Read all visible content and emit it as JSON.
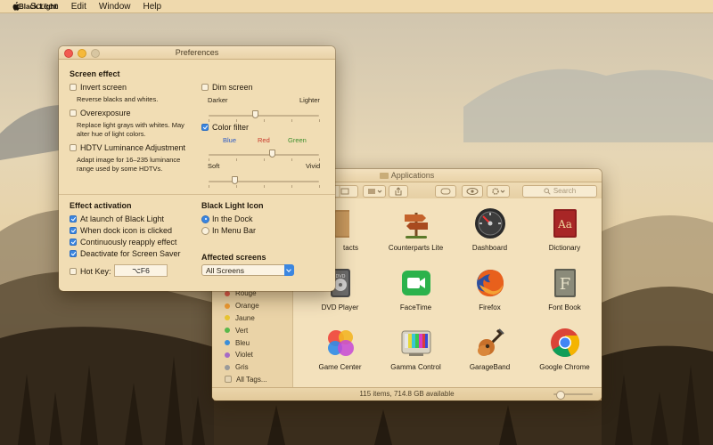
{
  "menubar": {
    "apple": "apple-logo-icon",
    "app_name": "Black Light",
    "items": [
      "Screen",
      "Edit",
      "Window",
      "Help"
    ]
  },
  "finder": {
    "title": "Applications",
    "search_placeholder": "Search",
    "status": "115 items, 714.8 GB available",
    "tags": [
      {
        "label": "Rouge",
        "color": "#e25a4b"
      },
      {
        "label": "Orange",
        "color": "#ef9b33"
      },
      {
        "label": "Jaune",
        "color": "#e8c431"
      },
      {
        "label": "Vert",
        "color": "#59b84a"
      },
      {
        "label": "Bleu",
        "color": "#3b8ed8"
      },
      {
        "label": "Violet",
        "color": "#a66bc5"
      },
      {
        "label": "Gris",
        "color": "#9a9a9a"
      },
      {
        "label": "All Tags..."
      }
    ],
    "apps": [
      {
        "name": "Contacts",
        "label": "tacts",
        "icon": "contacts-icon"
      },
      {
        "name": "Counterparts Lite",
        "label": "Counterparts Lite",
        "icon": "signpost-icon"
      },
      {
        "name": "Dashboard",
        "label": "Dashboard",
        "icon": "dashboard-gauge-icon"
      },
      {
        "name": "Dictionary",
        "label": "Dictionary",
        "icon": "dictionary-book-icon"
      },
      {
        "name": "DVD Player",
        "label": "DVD Player",
        "icon": "dvd-player-icon"
      },
      {
        "name": "FaceTime",
        "label": "FaceTime",
        "icon": "facetime-camera-icon"
      },
      {
        "name": "Firefox",
        "label": "Firefox",
        "icon": "firefox-icon"
      },
      {
        "name": "Font Book",
        "label": "Font Book",
        "icon": "font-book-icon"
      },
      {
        "name": "Game Center",
        "label": "Game Center",
        "icon": "game-center-icon"
      },
      {
        "name": "Gamma Control",
        "label": "Gamma Control",
        "icon": "gamma-tv-icon"
      },
      {
        "name": "GarageBand",
        "label": "GarageBand",
        "icon": "guitar-icon"
      },
      {
        "name": "Google Chrome",
        "label": "Google Chrome",
        "icon": "chrome-icon"
      }
    ]
  },
  "prefs": {
    "title": "Preferences",
    "screen_effect": {
      "heading": "Screen effect",
      "invert": {
        "label": "Invert screen",
        "checked": false,
        "desc": "Reverse blacks and whites."
      },
      "overexposure": {
        "label": "Overexposure",
        "checked": false,
        "desc1": "Replace light grays with whites. May",
        "desc2": "alter hue of light colors."
      },
      "hdtv": {
        "label": "HDTV Luminance Adjustment",
        "checked": false,
        "desc1": "Adapt image for 16–235 luminance",
        "desc2": "range used by some HDTVs."
      },
      "dim": {
        "label": "Dim screen",
        "checked": false,
        "darker": "Darker",
        "lighter": "Lighter",
        "value": 0.42
      },
      "color_filter": {
        "label": "Color filter",
        "checked": true,
        "blue": "Blue",
        "red": "Red",
        "green": "Green",
        "hue_value": 0.58,
        "soft": "Soft",
        "vivid": "Vivid",
        "intensity_value": 0.24
      },
      "colors": {
        "blue": "#2b59c3",
        "red": "#c8392b",
        "green": "#3e8f2e"
      }
    },
    "activation": {
      "heading": "Effect activation",
      "launch": {
        "label": "At launch of Black Light",
        "checked": true
      },
      "dock_click": {
        "label": "When dock icon is clicked",
        "checked": true
      },
      "reapply": {
        "label": "Continuously reapply effect",
        "checked": true
      },
      "screensaver": {
        "label": "Deactivate for Screen Saver",
        "checked": true
      },
      "hotkey": {
        "label": "Hot Key:",
        "checked": false,
        "value": "⌥F6"
      }
    },
    "icon": {
      "heading": "Black Light Icon",
      "dock": {
        "label": "In the Dock",
        "selected": true
      },
      "menubar": {
        "label": "In Menu Bar",
        "selected": false
      }
    },
    "affected": {
      "heading": "Affected screens",
      "value": "All Screens"
    }
  }
}
